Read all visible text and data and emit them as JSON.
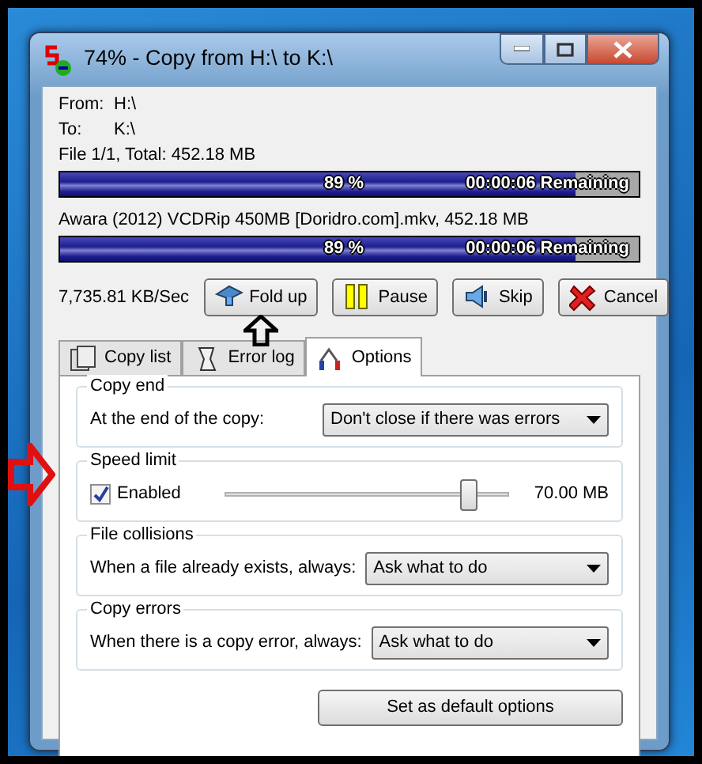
{
  "window": {
    "title": "74% - Copy from H:\\ to K:\\"
  },
  "source": {
    "label": "From:",
    "value": "H:\\"
  },
  "destination": {
    "label": "To:",
    "value": "K:\\"
  },
  "progress": [
    {
      "caption": "File 1/1, Total: 452.18 MB",
      "level": 0.89,
      "percent": "89 %",
      "remaining": "00:00:06 Remaining"
    },
    {
      "caption": "Awara (2012) VCDRip 450MB [Doridro.com].mkv, 452.18 MB",
      "level": 0.89,
      "percent": "89 %",
      "remaining": "00:00:06 Remaining"
    }
  ],
  "speed": "7,735.81 KB/Sec",
  "buttons": [
    {
      "kind": "foldup",
      "label": "Fold up"
    },
    {
      "kind": "pause",
      "label": "Pause"
    },
    {
      "kind": "skip",
      "label": "Skip"
    },
    {
      "kind": "cancel",
      "label": "Cancel"
    }
  ],
  "tabs": [
    {
      "kind": "list",
      "label": "Copy list",
      "selected": false
    },
    {
      "kind": "log",
      "label": "Error log",
      "selected": false
    },
    {
      "kind": "options",
      "label": "Options",
      "selected": true
    }
  ],
  "groups": [
    {
      "kind": "select",
      "title": "Copy end",
      "label": "At the end of the copy:",
      "value": "Don't close if there was errors"
    },
    {
      "kind": "slider",
      "title": "Speed limit",
      "checkbox": {
        "label": "Enabled",
        "checked": true
      },
      "level": 0.86,
      "reading": "70.00 MB"
    },
    {
      "kind": "select",
      "title": "File collisions",
      "label": "When a file already exists, always:",
      "value": "Ask what to do"
    },
    {
      "kind": "select",
      "title": "Copy errors",
      "label": "When there is a copy error, always:",
      "value": "Ask what to do"
    }
  ],
  "default_button": "Set as default options"
}
